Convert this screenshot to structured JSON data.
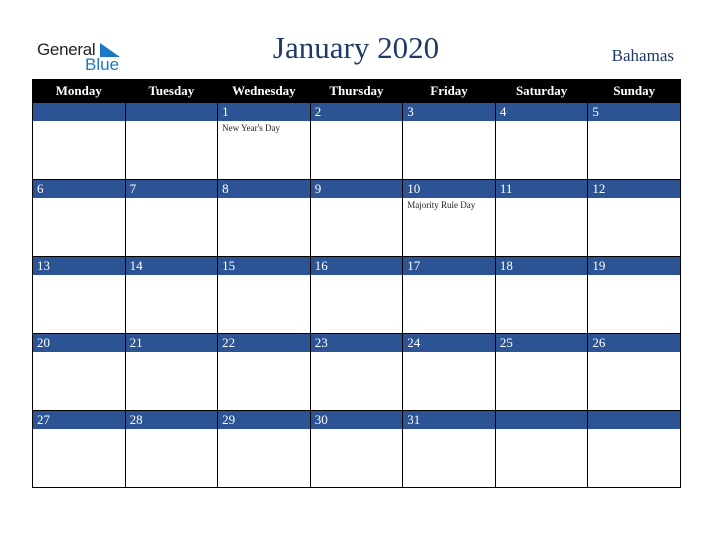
{
  "logo": {
    "line1": "General",
    "line2": "Blue"
  },
  "title": "January 2020",
  "country": "Bahamas",
  "weekdays": [
    "Monday",
    "Tuesday",
    "Wednesday",
    "Thursday",
    "Friday",
    "Saturday",
    "Sunday"
  ],
  "weeks": [
    [
      {
        "d": "",
        "h": ""
      },
      {
        "d": "",
        "h": ""
      },
      {
        "d": "1",
        "h": "New Year's Day"
      },
      {
        "d": "2",
        "h": ""
      },
      {
        "d": "3",
        "h": ""
      },
      {
        "d": "4",
        "h": ""
      },
      {
        "d": "5",
        "h": ""
      }
    ],
    [
      {
        "d": "6",
        "h": ""
      },
      {
        "d": "7",
        "h": ""
      },
      {
        "d": "8",
        "h": ""
      },
      {
        "d": "9",
        "h": ""
      },
      {
        "d": "10",
        "h": "Majority Rule Day"
      },
      {
        "d": "11",
        "h": ""
      },
      {
        "d": "12",
        "h": ""
      }
    ],
    [
      {
        "d": "13",
        "h": ""
      },
      {
        "d": "14",
        "h": ""
      },
      {
        "d": "15",
        "h": ""
      },
      {
        "d": "16",
        "h": ""
      },
      {
        "d": "17",
        "h": ""
      },
      {
        "d": "18",
        "h": ""
      },
      {
        "d": "19",
        "h": ""
      }
    ],
    [
      {
        "d": "20",
        "h": ""
      },
      {
        "d": "21",
        "h": ""
      },
      {
        "d": "22",
        "h": ""
      },
      {
        "d": "23",
        "h": ""
      },
      {
        "d": "24",
        "h": ""
      },
      {
        "d": "25",
        "h": ""
      },
      {
        "d": "26",
        "h": ""
      }
    ],
    [
      {
        "d": "27",
        "h": ""
      },
      {
        "d": "28",
        "h": ""
      },
      {
        "d": "29",
        "h": ""
      },
      {
        "d": "30",
        "h": ""
      },
      {
        "d": "31",
        "h": ""
      },
      {
        "d": "",
        "h": ""
      },
      {
        "d": "",
        "h": ""
      }
    ]
  ],
  "colors": {
    "header_bg": "#000000",
    "date_bar": "#2c5494",
    "title": "#1e3a66",
    "logo_blue": "#1d78c4"
  }
}
